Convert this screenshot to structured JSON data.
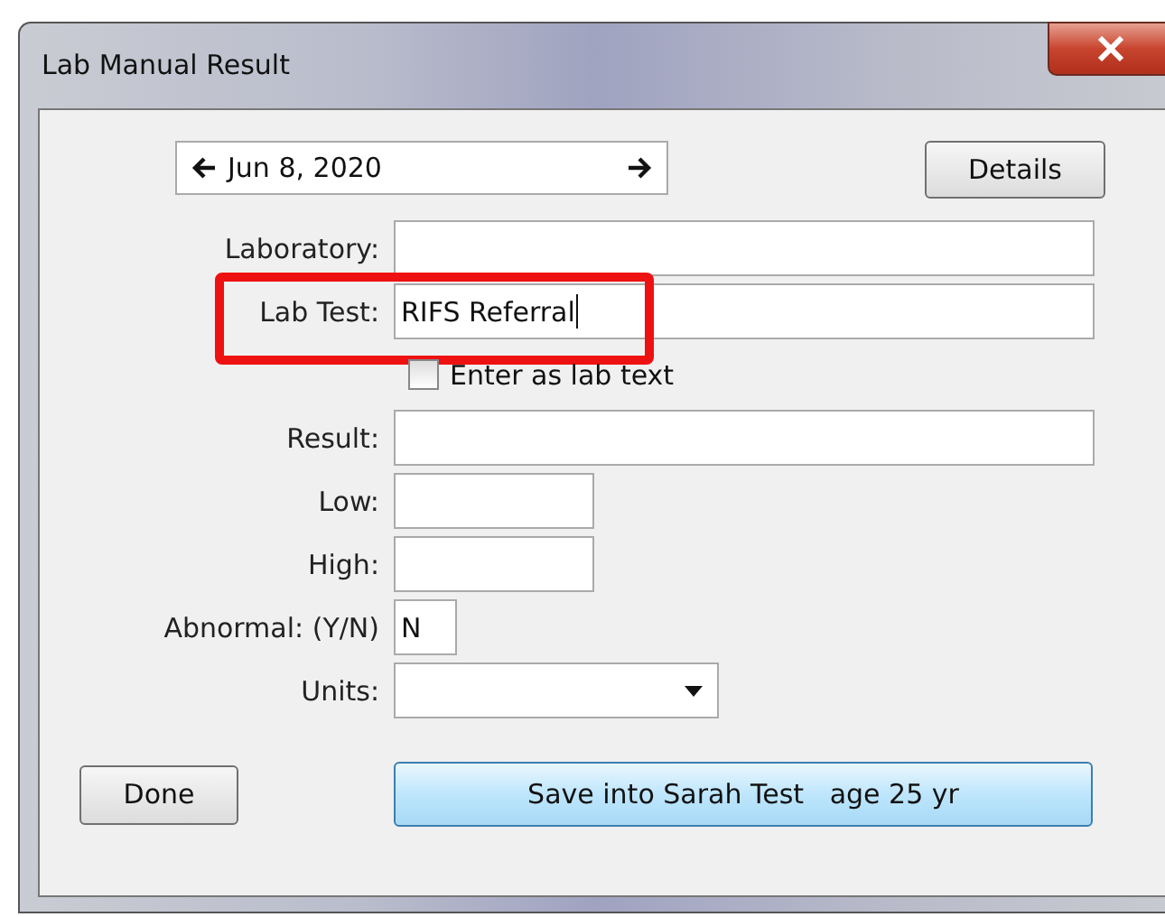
{
  "window": {
    "title": "Lab Manual Result"
  },
  "date_nav": {
    "date": "Jun 8, 2020"
  },
  "details_button": "Details",
  "fields": [
    {
      "kind": "wide-text",
      "label": "Laboratory:",
      "highlighted": false,
      "focused": false
    },
    {
      "kind": "wide-text",
      "label": "Lab Test:",
      "value": "RIFS Referral",
      "highlighted": true,
      "focused": true
    },
    {
      "kind": "checkbox",
      "label": "Enter as lab text",
      "checked": false
    },
    {
      "kind": "wide-text",
      "label": "Result:",
      "highlighted": false,
      "focused": false
    },
    {
      "kind": "short-text",
      "label": "Low:",
      "highlighted": false,
      "focused": false
    },
    {
      "kind": "short-text",
      "label": "High:",
      "highlighted": false,
      "focused": false
    },
    {
      "kind": "tiny-text",
      "label": "Abnormal: (Y/N)",
      "value": "N",
      "highlighted": false,
      "focused": false
    },
    {
      "kind": "dropdown",
      "label": "Units:"
    }
  ],
  "buttons": [
    {
      "label": "Done",
      "kind": "plain"
    },
    {
      "label": "Save into Sarah Test   age 25 yr",
      "kind": "primary"
    }
  ]
}
